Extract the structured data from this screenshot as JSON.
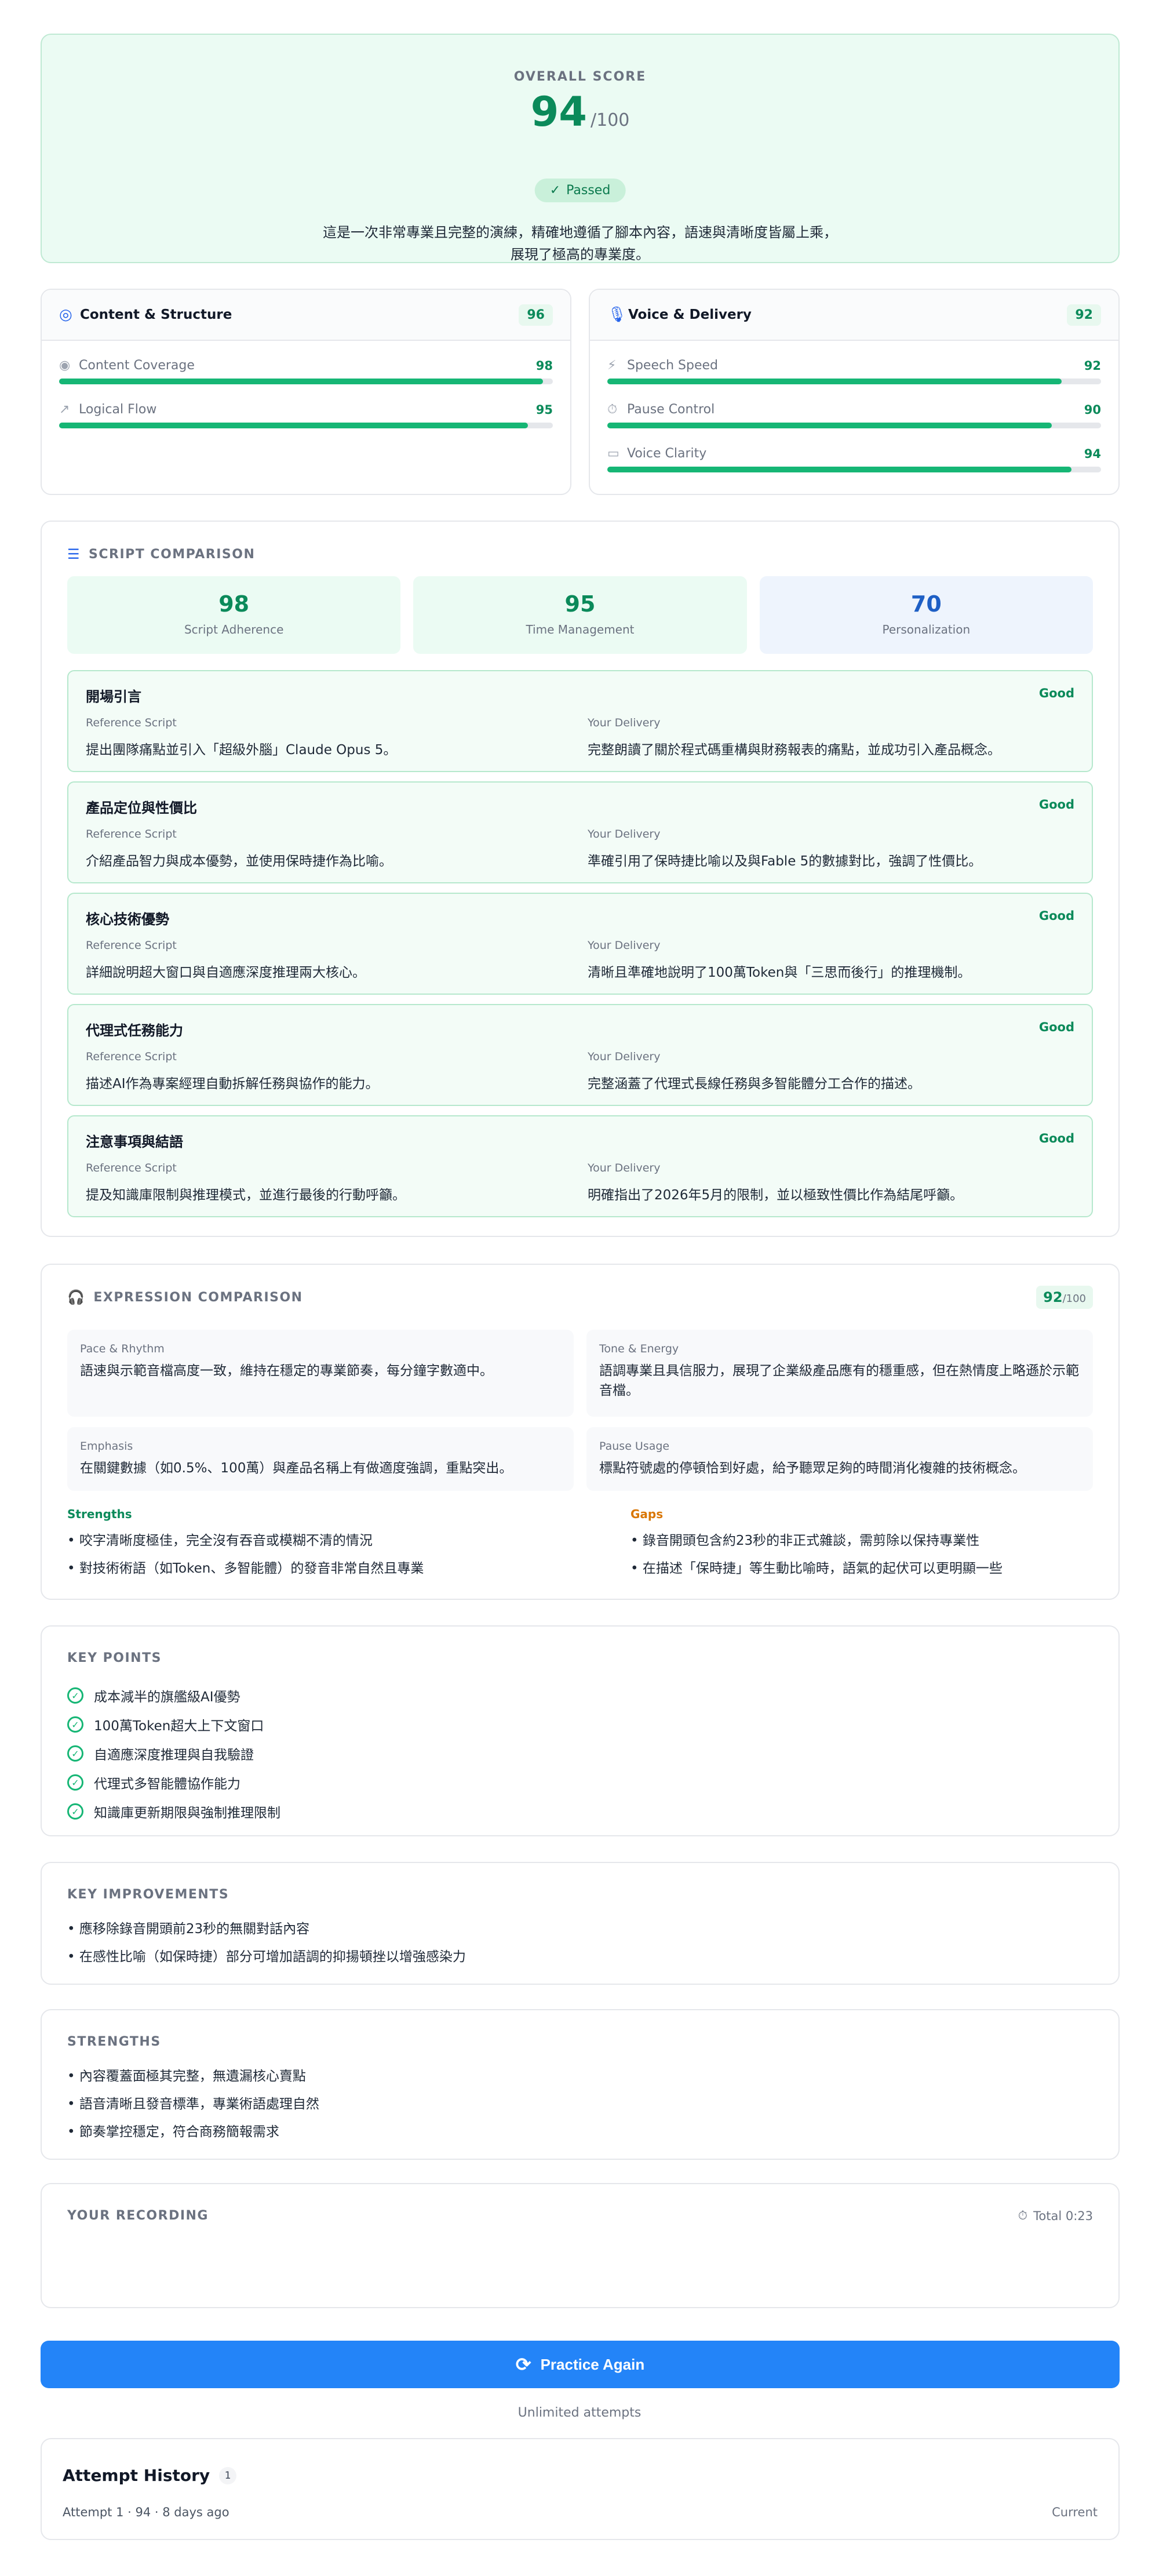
{
  "overall": {
    "label": "OVERALL SCORE",
    "score": "94",
    "denominator": "/100",
    "badge": "Passed",
    "summary_line1": "這是一次非常專業且完整的演練，精確地遵循了腳本內容，語速與清晰度皆屬上乘，",
    "summary_line2": "展現了極高的專業度。"
  },
  "content_structure": {
    "title": "Content & Structure",
    "score": "96",
    "metrics": [
      {
        "name": "Content Coverage",
        "value": "98",
        "fill": 98
      },
      {
        "name": "Logical Flow",
        "value": "95",
        "fill": 95
      }
    ]
  },
  "voice_delivery": {
    "title": "Voice & Delivery",
    "score": "92",
    "metrics": [
      {
        "name": "Speech Speed",
        "value": "92",
        "fill": 92
      },
      {
        "name": "Pause Control",
        "value": "90",
        "fill": 90
      },
      {
        "name": "Voice Clarity",
        "value": "94",
        "fill": 94
      }
    ]
  },
  "script_comparison": {
    "label": "SCRIPT COMPARISON",
    "tiles": [
      {
        "value": "98",
        "label": "Script Adherence"
      },
      {
        "value": "95",
        "label": "Time Management"
      },
      {
        "value": "70",
        "label": "Personalization"
      }
    ],
    "ref_caption": "Reference Script",
    "yours_caption": "Your Delivery",
    "sections": [
      {
        "title": "開場引言",
        "rating": "Good",
        "reference": "提出團隊痛點並引入「超級外腦」Claude Opus 5。",
        "delivery": "完整朗讀了關於程式碼重構與財務報表的痛點，並成功引入產品概念。"
      },
      {
        "title": "產品定位與性價比",
        "rating": "Good",
        "reference": "介紹產品智力與成本優勢，並使用保時捷作為比喻。",
        "delivery": "準確引用了保時捷比喻以及與Fable 5的數據對比，強調了性價比。"
      },
      {
        "title": "核心技術優勢",
        "rating": "Good",
        "reference": "詳細說明超大窗口與自適應深度推理兩大核心。",
        "delivery": "清晰且準確地說明了100萬Token與「三思而後行」的推理機制。"
      },
      {
        "title": "代理式任務能力",
        "rating": "Good",
        "reference": "描述AI作為專案經理自動拆解任務與協作的能力。",
        "delivery": "完整涵蓋了代理式長線任務與多智能體分工合作的描述。"
      },
      {
        "title": "注意事項與結語",
        "rating": "Good",
        "reference": "提及知識庫限制與推理模式，並進行最後的行動呼籲。",
        "delivery": "明確指出了2026年5月的限制，並以極致性價比作為結尾呼籲。"
      }
    ]
  },
  "expression_comparison": {
    "label": "EXPRESSION COMPARISON",
    "score": "92",
    "denominator": "/100",
    "boxes": [
      {
        "caption": "Pace & Rhythm",
        "text": "語速與示範音檔高度一致，維持在穩定的專業節奏，每分鐘字數適中。"
      },
      {
        "caption": "Tone & Energy",
        "text": "語調專業且具信服力，展現了企業級產品應有的穩重感，但在熱情度上略遜於示範音檔。"
      },
      {
        "caption": "Emphasis",
        "text": "在關鍵數據（如0.5%、100萬）與產品名稱上有做適度強調，重點突出。"
      },
      {
        "caption": "Pause Usage",
        "text": "標點符號處的停頓恰到好處，給予聽眾足夠的時間消化複雜的技術概念。"
      }
    ],
    "strengths_label": "Strengths",
    "strengths": [
      "• 咬字清晰度極佳，完全沒有吞音或模糊不清的情況",
      "• 對技術術語（如Token、多智能體）的發音非常自然且專業"
    ],
    "gaps_label": "Gaps",
    "gaps": [
      "• 錄音開頭包含約23秒的非正式雜談，需剪除以保持專業性",
      "• 在描述「保時捷」等生動比喻時，語氣的起伏可以更明顯一些"
    ]
  },
  "key_points": {
    "label": "KEY POINTS",
    "items": [
      "成本減半的旗艦級AI優勢",
      "100萬Token超大上下文窗口",
      "自適應深度推理與自我驗證",
      "代理式多智能體協作能力",
      "知識庫更新期限與強制推理限制"
    ]
  },
  "key_improvements": {
    "label": "KEY IMPROVEMENTS",
    "items": [
      "• 應移除錄音開頭前23秒的無關對話內容",
      "• 在感性比喻（如保時捷）部分可增加語調的抑揚頓挫以增強感染力"
    ]
  },
  "strengths": {
    "label": "STRENGTHS",
    "items": [
      "• 內容覆蓋面極其完整，無遺漏核心賣點",
      "• 語音清晰且發音標準，專業術語處理自然",
      "• 節奏掌控穩定，符合商務簡報需求"
    ]
  },
  "recording": {
    "label": "YOUR RECORDING",
    "total": "Total 0:23"
  },
  "practice_button": "Practice Again",
  "unlimited": "Unlimited attempts",
  "history": {
    "title": "Attempt History",
    "count": "1",
    "row": "Attempt 1 · 94 · 8 days ago",
    "status": "Current"
  },
  "colors": {
    "accent_green": "#0b8a5a",
    "bar_green": "#16b675",
    "primary_blue": "#2384f8",
    "gap_orange": "#d97706"
  }
}
